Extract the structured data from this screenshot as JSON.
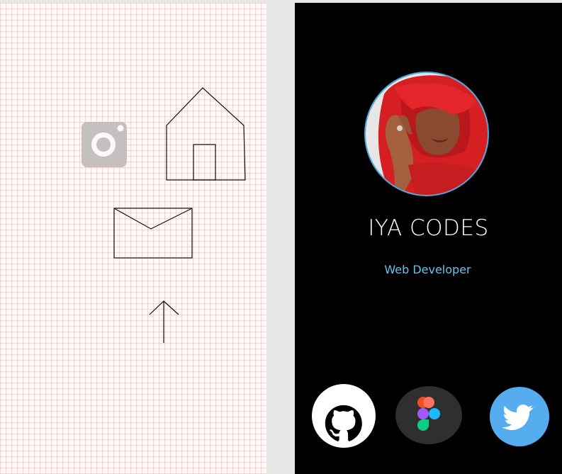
{
  "profile": {
    "name": "IYA CODES",
    "role": "Web Developer"
  },
  "colors": {
    "phone_background": "#000000",
    "role_text": "#6ac2ea",
    "avatar_ring": "#4aa8e0",
    "twitter_blue": "#55acee",
    "figma_bg": "#2f2f2f"
  },
  "sketch_icons": [
    "instagram-icon",
    "home-icon",
    "mail-icon",
    "arrow-up-icon"
  ],
  "social_links": [
    "github-icon",
    "figma-icon",
    "twitter-icon"
  ]
}
